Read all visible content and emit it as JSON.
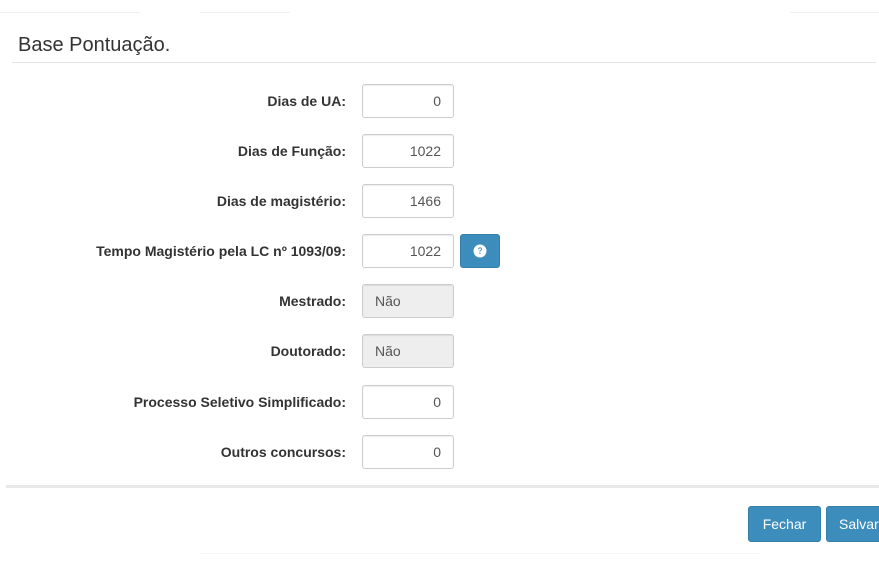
{
  "modal": {
    "title": "Base Pontuação.",
    "fields": [
      {
        "label": "Dias de UA:",
        "value": "0"
      },
      {
        "label": "Dias de Função:",
        "value": "1022"
      },
      {
        "label": "Dias de magistério:",
        "value": "1466"
      },
      {
        "label": "Tempo Magistério pela LC nº 1093/09:",
        "value": "1022"
      },
      {
        "label": "Mestrado:",
        "value": "Não"
      },
      {
        "label": "Doutorado:",
        "value": "Não"
      },
      {
        "label": "Processo Seletivo Simplificado:",
        "value": "0"
      },
      {
        "label": "Outros concursos:",
        "value": "0"
      }
    ],
    "help_icon": "question-circle-icon",
    "buttons": {
      "close_label": "Fechar",
      "save_label": "Salvar"
    }
  },
  "colors": {
    "primary": "#3c8dbc",
    "primary_border": "#367fa9",
    "readonly_bg": "#eeeeee",
    "text": "#333333"
  }
}
